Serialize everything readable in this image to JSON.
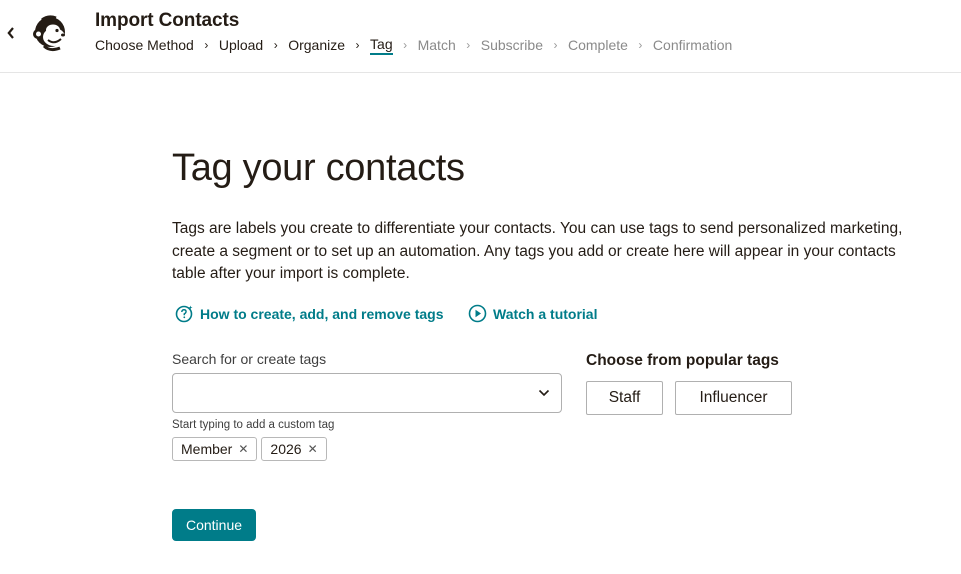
{
  "header": {
    "title": "Import Contacts",
    "breadcrumbs": [
      {
        "label": "Choose Method",
        "state": "done"
      },
      {
        "label": "Upload",
        "state": "done"
      },
      {
        "label": "Organize",
        "state": "done"
      },
      {
        "label": "Tag",
        "state": "current"
      },
      {
        "label": "Match",
        "state": "todo"
      },
      {
        "label": "Subscribe",
        "state": "todo"
      },
      {
        "label": "Complete",
        "state": "todo"
      },
      {
        "label": "Confirmation",
        "state": "todo"
      }
    ]
  },
  "main": {
    "heading": "Tag your contacts",
    "description": "Tags are labels you create to differentiate your contacts. You can use tags to send personalized marketing, create a segment or to set up an automation. Any tags you add or create here will appear in your contacts table after your import is complete.",
    "links": {
      "how_to": "How to create, add, and remove tags",
      "tutorial": "Watch a tutorial"
    },
    "search": {
      "label": "Search for or create tags",
      "value": "",
      "placeholder": "",
      "hint": "Start typing to add a custom tag"
    },
    "selected_tags": [
      "Member",
      "2026"
    ],
    "popular": {
      "label": "Choose from popular tags",
      "tags": [
        "Staff",
        "Influencer"
      ]
    },
    "continue_label": "Continue"
  },
  "icons": {
    "back": "chevron-left-icon",
    "logo": "mailchimp-freddie-logo",
    "help": "question-sparkle-icon",
    "play": "play-circle-icon",
    "dropdown": "chevron-down-icon",
    "remove": "close-icon"
  },
  "colors": {
    "accent": "#007c89",
    "text": "#241c15",
    "muted": "#8a8a8a"
  }
}
